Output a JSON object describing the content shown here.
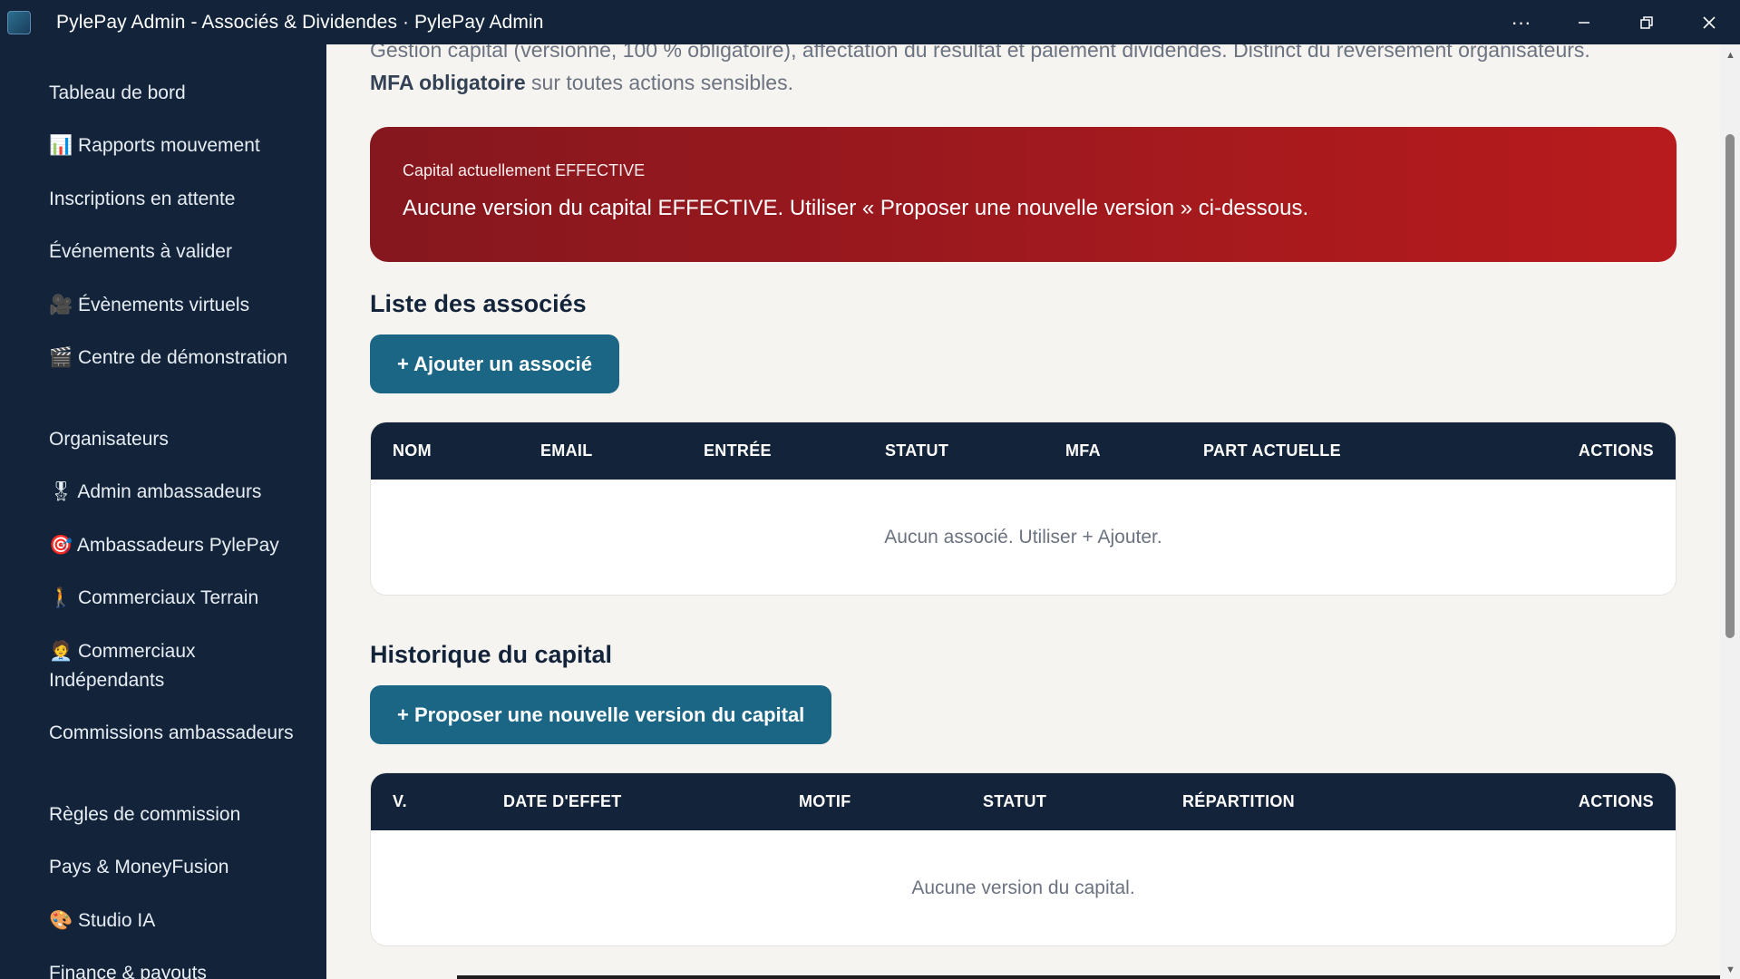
{
  "window": {
    "title": "PylePay Admin - Associés & Dividendes · PylePay Admin",
    "logo_text": "PylePay",
    "controls": {
      "more": "···",
      "minimize": "—",
      "restore": "❐",
      "close": "✕"
    }
  },
  "sidebar": {
    "items": [
      {
        "label": "Tableau de bord"
      },
      {
        "label": "📊 Rapports mouvement"
      },
      {
        "label": "Inscriptions en attente"
      },
      {
        "label": "Événements à valider"
      },
      {
        "label": "🎥 Évènements virtuels"
      },
      {
        "label": "🎬 Centre de démonstration"
      },
      {
        "label": "Organisateurs"
      },
      {
        "label": "🎖 Admin ambassadeurs"
      },
      {
        "label": "🎯 Ambassadeurs PylePay"
      },
      {
        "label": "🚶 Commerciaux Terrain"
      },
      {
        "label": "🧑‍💼 Commerciaux Indépendants"
      },
      {
        "label": "Commissions ambassadeurs"
      },
      {
        "label": "Règles de commission"
      },
      {
        "label": "Pays & MoneyFusion"
      },
      {
        "label": "🎨 Studio IA"
      },
      {
        "label": "Finance & payouts"
      }
    ]
  },
  "main": {
    "intro_line1": "Gestion capital (versionné, 100 % obligatoire), affectation du résultat et paiement dividendes. Distinct du reversement organisateurs.",
    "intro_bold": "MFA obligatoire",
    "intro_rest": " sur toutes actions sensibles.",
    "alert": {
      "label": "Capital actuellement EFFECTIVE",
      "message": "Aucune version du capital EFFECTIVE. Utiliser « Proposer une nouvelle version » ci-dessous."
    },
    "associates": {
      "title": "Liste des associés",
      "add_button": "+ Ajouter un associé",
      "columns": [
        "NOM",
        "EMAIL",
        "ENTRÉE",
        "STATUT",
        "MFA",
        "PART ACTUELLE",
        "ACTIONS"
      ],
      "empty": "Aucun associé. Utiliser + Ajouter."
    },
    "capital": {
      "title": "Historique du capital",
      "propose_button": "+ Proposer une nouvelle version du capital",
      "columns": [
        "V.",
        "DATE D'EFFET",
        "MOTIF",
        "STATUT",
        "RÉPARTITION",
        "ACTIONS"
      ],
      "empty": "Aucune version du capital."
    }
  },
  "colors": {
    "sidebar_bg": "#13243a",
    "page_bg": "#f6f4f0",
    "alert_start": "#85171e",
    "alert_end": "#b81b1d",
    "button_bg": "#1b6585",
    "table_header_bg": "#13243a"
  }
}
